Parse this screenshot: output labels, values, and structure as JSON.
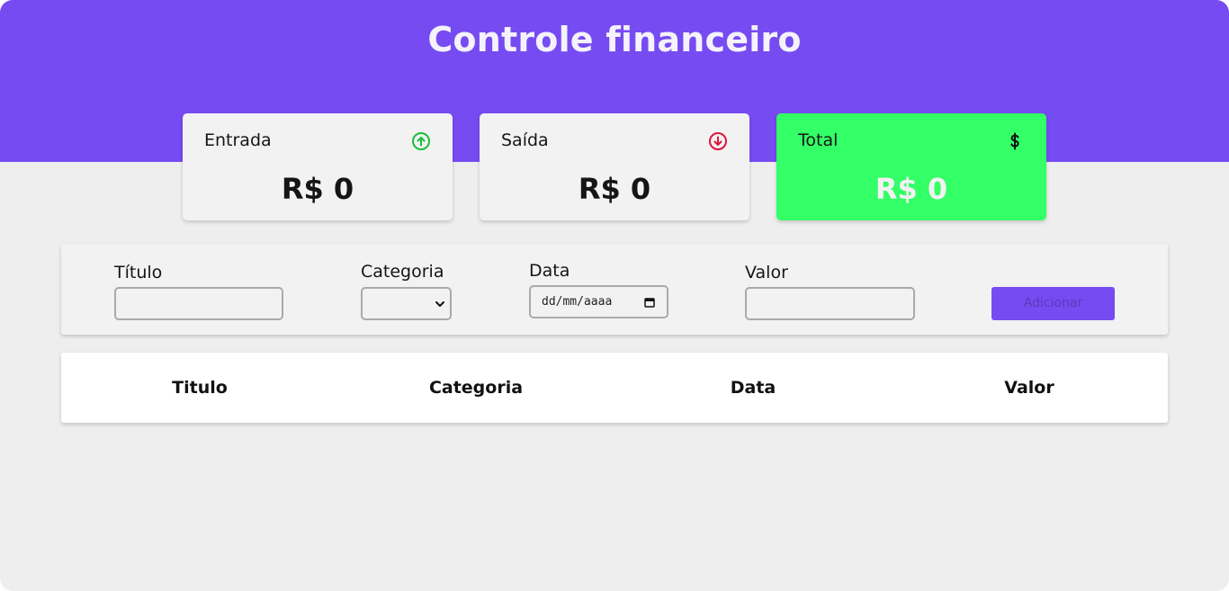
{
  "app": {
    "title": "Controle financeiro"
  },
  "summary": {
    "income": {
      "label": "Entrada",
      "value": "R$ 0",
      "icon": "arrow-up-circle-icon",
      "icon_color": "#1bbf3a"
    },
    "expense": {
      "label": "Saída",
      "value": "R$ 0",
      "icon": "arrow-down-circle-icon",
      "icon_color": "#e0143c"
    },
    "total": {
      "label": "Total",
      "value": "R$ 0",
      "icon": "dollar-icon",
      "card_color": "#33ff66"
    }
  },
  "form": {
    "title_label": "Título",
    "title_value": "",
    "category_label": "Categoria",
    "category_value": "",
    "date_label": "Data",
    "date_placeholder": "dd/mm/aaaa",
    "amount_label": "Valor",
    "amount_value": "",
    "submit_label": "Adicionar"
  },
  "table": {
    "columns": [
      "Titulo",
      "Categoria",
      "Data",
      "Valor"
    ],
    "rows": []
  },
  "colors": {
    "accent": "#774bf2",
    "background": "#eeeeee",
    "card": "#f2f2f2"
  }
}
